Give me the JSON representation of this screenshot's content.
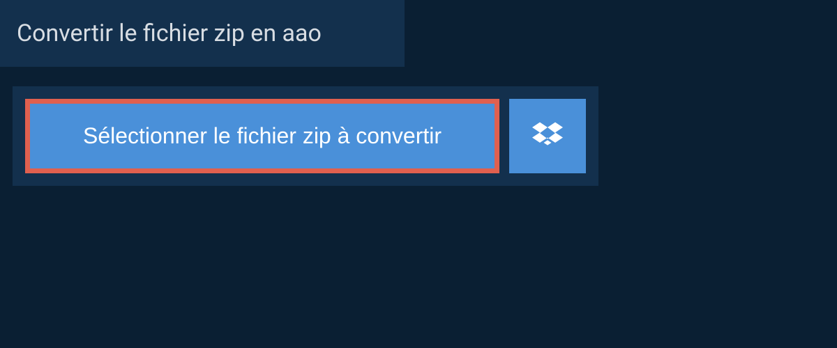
{
  "header": {
    "title": "Convertir le fichier zip en aao"
  },
  "actions": {
    "select_file_label": "Sélectionner le fichier zip à convertir"
  },
  "colors": {
    "bg_dark": "#0a1f33",
    "bg_panel": "#13304d",
    "button_blue": "#4a90d9",
    "highlight_border": "#e0604f"
  }
}
